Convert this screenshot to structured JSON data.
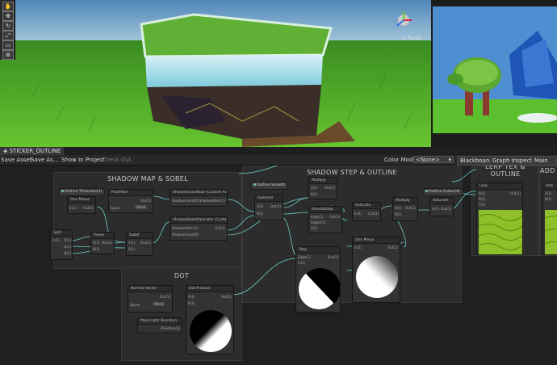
{
  "tab": {
    "title": "STICKER_OUTLINE"
  },
  "toolbar": {
    "save_asset": "Save Asset",
    "save_as": "Save As...",
    "show_in_project": "Show In Project",
    "check_out": "Check Out",
    "color_mode_label": "Color Mode",
    "color_mode_value": "<None>",
    "blackboard": "Blackboard",
    "graph_inspector": "Graph Inspector",
    "main_preview": "Main Previ"
  },
  "scene": {
    "persp_label": "< Persp"
  },
  "groups": {
    "shadow_sobel": "SHADOW MAP & SOBEL",
    "shadow_step": "SHADOW STEP & OUTLINE",
    "dot": "DOT",
    "lerp": "LERP TEX & OUTLINE",
    "add": "ADD S"
  },
  "nodes": {
    "outline_thickness": "Outline Thickness(1)",
    "one_minus_1": "One Minus",
    "postfilter": "PostFilter",
    "shadowcoord": "ShadowCoordSub (Custom Function)",
    "sampled_op": "ShadowSobelOperator (Custom Function)",
    "split": "Split",
    "power": "Power",
    "sobel": "Sobel",
    "outline_smooth": "Outline Smooth",
    "subtract": "Subtract",
    "multiply_1": "Multiply",
    "smoothstep": "Smoothstep",
    "saturate_1": "Saturate",
    "multiply_2": "Multiply",
    "outline_color": "Outline Colour(4)",
    "saturate_2": "Saturate",
    "step": "Step",
    "one_minus_2": "One Minus",
    "lerp": "Lerp",
    "add": "Add",
    "normal_vector": "Normal Vector",
    "main_light": "Main Light Direction",
    "dot_product": "Dot Product"
  },
  "ports": {
    "in": "In(1)",
    "out": "Out(1)",
    "a": "A(1)",
    "b": "B(1)",
    "t": "T(1)",
    "edge": "Edge(1)",
    "edge2": "Edge2(1)",
    "x": "X(1)",
    "space": "Space",
    "space_value": "World",
    "world": "World",
    "shadow_color": "ShadowCoord(4)",
    "shadow_atten": "ShadowAtten(1)",
    "direction": "Direction(3)",
    "r": "R(1)",
    "g": "G(1)",
    "b_ch": "B(1)",
    "a_ch": "A(1)",
    "tex": "Tex(4)",
    "uv": "UV(4)",
    "base": "Base(1)"
  },
  "colors": {
    "wire": "#6fd1d1",
    "accent": "#7fc6c6",
    "grass": "#5dbb2a",
    "sky": "#72a8d0"
  }
}
